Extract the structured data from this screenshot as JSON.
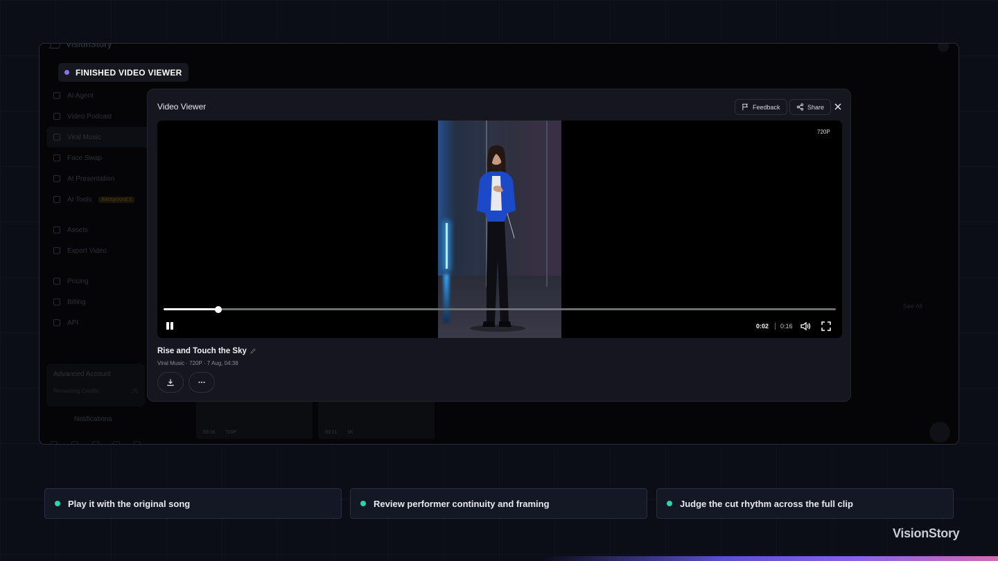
{
  "app": {
    "brand": "VisionStory",
    "sidebar": {
      "items": [
        {
          "label": "AI Agent"
        },
        {
          "label": "Video Podcast"
        },
        {
          "label": "Viral Music"
        },
        {
          "label": "Face Swap"
        },
        {
          "label": "AI Presentation"
        },
        {
          "label": "AI Tools",
          "badge": "Background 3"
        },
        {
          "label": "Assets"
        },
        {
          "label": "Export Video"
        },
        {
          "label": "Pricing"
        },
        {
          "label": "Billing"
        },
        {
          "label": "API"
        }
      ],
      "account_label": "Advanced Account",
      "credits_label": "Remaining Credits",
      "credits_value": "26",
      "notifications_label": "Notifications"
    },
    "see_all": "See All",
    "thumbnails": [
      {
        "duration": "00:16",
        "resolution": "720P"
      },
      {
        "duration": "00:21",
        "resolution": "1K"
      }
    ]
  },
  "section_tag": {
    "label": "FINISHED VIDEO VIEWER",
    "dot_color": "#8b6ff7"
  },
  "viewer": {
    "title": "Video Viewer",
    "feedback_label": "Feedback",
    "share_label": "Share",
    "resolution_badge": "720P",
    "progress_fraction": 0.081,
    "current_time": "0:02",
    "total_time": "0:16",
    "video_title": "Rise and Touch the Sky",
    "video_meta": "Viral Music · 720P · 7 Aug, 04:38",
    "icons": {
      "feedback": "flag-icon",
      "share": "share-icon",
      "close": "close-icon",
      "pause": "pause-icon",
      "volume": "volume-icon",
      "fullscreen": "fullscreen-icon",
      "edit": "pencil-icon",
      "download": "download-icon",
      "more": "more-icon"
    }
  },
  "highlights": [
    {
      "text": "Play it with the original song"
    },
    {
      "text": "Review performer continuity and framing"
    },
    {
      "text": "Judge the cut rhythm across the full clip"
    }
  ],
  "highlight_dot_color": "#2fd4a7",
  "footer_brand": "VisionStory"
}
